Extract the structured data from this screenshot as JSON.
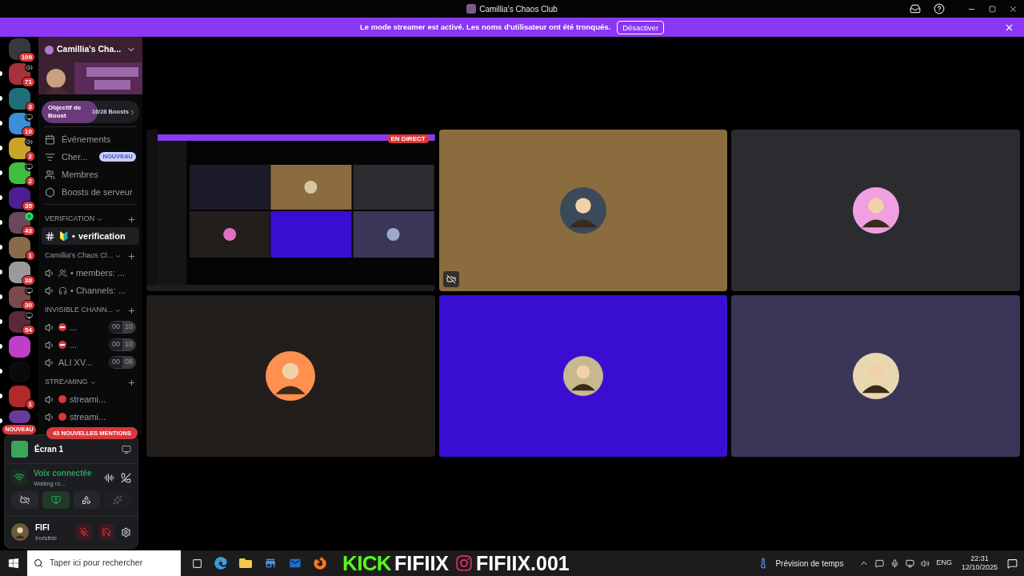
{
  "window": {
    "title": "Camillia's Chaos Club"
  },
  "banner": {
    "text": "Le mode streamer est activé. Les noms d'utilisateur ont été tronqués.",
    "button": "Désactiver"
  },
  "servers": [
    {
      "badge": "109",
      "kind": "plain",
      "unread": false,
      "color": "#36393f"
    },
    {
      "badge": "71",
      "kind": "voice",
      "unread": true,
      "color": "#a8323a"
    },
    {
      "badge": "3",
      "kind": "plain",
      "unread": true,
      "color": "#1f6f7a"
    },
    {
      "badge": "10",
      "kind": "screen",
      "unread": true,
      "color": "#3a8fd8"
    },
    {
      "badge": "2",
      "kind": "voice",
      "unread": true,
      "color": "#c9a227"
    },
    {
      "badge": "2",
      "kind": "screen",
      "unread": true,
      "color": "#3fbf3f"
    },
    {
      "badge": "35",
      "kind": "plain",
      "unread": true,
      "color": "#4b1f8f"
    },
    {
      "badge": "43",
      "kind": "chat",
      "unread": true,
      "color": "#6a4a5a"
    },
    {
      "badge": "1",
      "kind": "plain",
      "unread": true,
      "color": "#8a6a4a"
    },
    {
      "badge": "38",
      "kind": "plain",
      "unread": true,
      "color": "#9a9a9a"
    },
    {
      "badge": "30",
      "kind": "screen",
      "unread": true,
      "color": "#7a4a4a"
    },
    {
      "badge": "54",
      "kind": "screen",
      "unread": true,
      "color": "#5a2a3a"
    },
    {
      "kind": "plain",
      "unread": true,
      "color": "#c03fc8"
    },
    {
      "kind": "plain",
      "unread": true,
      "color": "#0a0a0a"
    },
    {
      "badge": "1",
      "kind": "plain",
      "unread": true,
      "color": "#b02a2a"
    },
    {
      "label": "NOUVEAU",
      "kind": "plain",
      "unread": true,
      "color": "#6a3a9a"
    }
  ],
  "server": {
    "name": "Camillia's Cha...",
    "boost": {
      "label": "Objectif de Boost",
      "count": "16/28 Boosts",
      "level": 0.57
    }
  },
  "menu": [
    {
      "label": "Événements"
    },
    {
      "label": "Cher...",
      "badge": "NOUVEAU"
    },
    {
      "label": "Membres"
    },
    {
      "label": "Boosts de serveur"
    }
  ],
  "categories": [
    {
      "name": "VERIFICATION",
      "channels": [
        {
          "kind": "text",
          "name": "verification",
          "prefix": "🔰 •",
          "selected": true
        }
      ]
    },
    {
      "name": "Camillia's Chaos Cl...",
      "channels": [
        {
          "kind": "members",
          "name": "• members: ...",
          "selected": false
        },
        {
          "kind": "headphones",
          "name": "• Channels: ...",
          "selected": false
        }
      ]
    },
    {
      "name": "INVISIBLE CHANN...",
      "channels": [
        {
          "kind": "blocked",
          "name": "...",
          "users": "00",
          "limit": "10",
          "selected": false
        },
        {
          "kind": "blocked",
          "name": "...",
          "users": "00",
          "limit": "10",
          "selected": false
        },
        {
          "kind": "voice",
          "name": "ALI XV...",
          "users": "00",
          "limit": "08",
          "selected": false
        }
      ]
    },
    {
      "name": "STREAMING",
      "channels": [
        {
          "kind": "live",
          "name": "streami...",
          "selected": false
        },
        {
          "kind": "live",
          "name": "streami...",
          "selected": false
        }
      ]
    }
  ],
  "mentions": "43 NOUVELLES MENTIONS",
  "stream_panel": {
    "title": "Écran 1"
  },
  "voice": {
    "status": "Voix connectée",
    "channel": "Waiting ro..."
  },
  "controls": [
    {
      "kind": "camera",
      "on": false
    },
    {
      "kind": "screen",
      "on": true
    },
    {
      "kind": "activities",
      "on": false
    },
    {
      "kind": "soundboard",
      "on": false,
      "disabled": true
    }
  ],
  "user": {
    "name": "FIFI",
    "status": "Invisible",
    "muted": true,
    "deafened": true
  },
  "tiles": [
    {
      "kind": "stream",
      "badge": "EN DIRECT"
    },
    {
      "kind": "participant",
      "color": "#8a6c3e",
      "camera_off": true
    },
    {
      "kind": "participant",
      "color": "#2a2c30",
      "camera_off": false
    },
    {
      "kind": "participant",
      "color": "#221e1b",
      "camera_off": false
    },
    {
      "kind": "participant",
      "color": "#3a0ed2",
      "camera_off": false
    },
    {
      "kind": "participant",
      "color": "#393658",
      "camera_off": false
    }
  ],
  "taskbar": {
    "search": "Taper ici pour rechercher",
    "overlay": [
      "KICK",
      "FIFIIX",
      "FIFIIX.001"
    ],
    "weather": "Prévision de temps",
    "language": "ENG",
    "time": "22:31",
    "date": "12/10/2025"
  }
}
